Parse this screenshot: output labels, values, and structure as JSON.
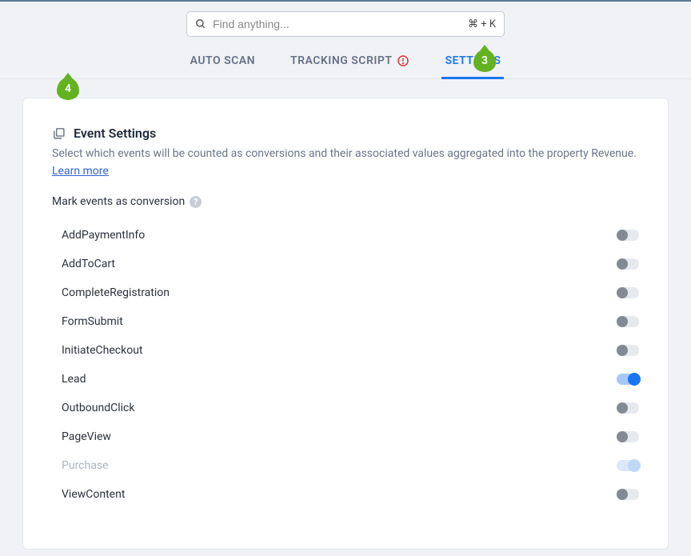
{
  "search": {
    "placeholder": "Find anything...",
    "shortcut": "⌘ + K"
  },
  "tabs": {
    "auto_scan": "AUTO SCAN",
    "tracking_script": "TRACKING SCRIPT",
    "settings": "SETTINGS"
  },
  "callouts": {
    "c3": "3",
    "c4": "4"
  },
  "section": {
    "title": "Event Settings",
    "description": "Select which events will be counted as conversions and their associated values aggregated into the property Revenue.",
    "learn_more": "Learn more"
  },
  "mark_label": "Mark events as conversion",
  "events": [
    {
      "name": "AddPaymentInfo",
      "on": false,
      "faded": false
    },
    {
      "name": "AddToCart",
      "on": false,
      "faded": false
    },
    {
      "name": "CompleteRegistration",
      "on": false,
      "faded": false
    },
    {
      "name": "FormSubmit",
      "on": false,
      "faded": false
    },
    {
      "name": "InitiateCheckout",
      "on": false,
      "faded": false
    },
    {
      "name": "Lead",
      "on": true,
      "faded": false
    },
    {
      "name": "OutboundClick",
      "on": false,
      "faded": false
    },
    {
      "name": "PageView",
      "on": false,
      "faded": false
    },
    {
      "name": "Purchase",
      "on": true,
      "faded": true
    },
    {
      "name": "ViewContent",
      "on": false,
      "faded": false
    }
  ]
}
